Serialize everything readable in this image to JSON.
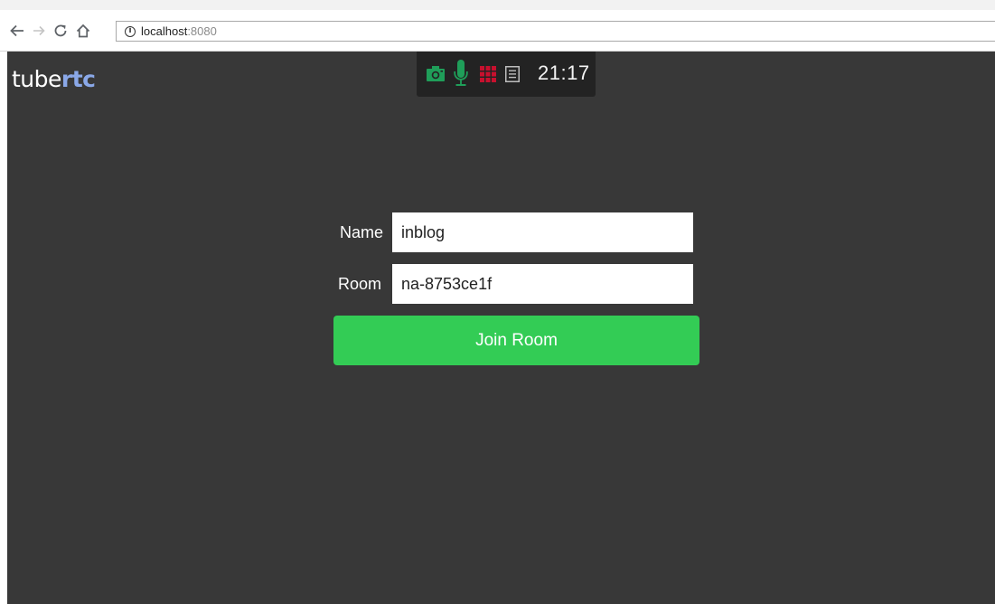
{
  "browser": {
    "url_host": "localhost",
    "url_port": ":8080",
    "icons": [
      "back-arrow-icon",
      "forward-arrow-icon",
      "reload-icon",
      "home-icon",
      "info-icon"
    ]
  },
  "app": {
    "brand_part1": "tube",
    "brand_part2": "rtc",
    "brand_colors": {
      "part1": "#ffffff",
      "part2": "#8aa8e8"
    }
  },
  "status_bar": {
    "time": "21:17",
    "icons": [
      {
        "name": "camera-icon",
        "color": "#1f9e59"
      },
      {
        "name": "microphone-icon",
        "color": "#1f9e59"
      },
      {
        "name": "grid-icon",
        "color": "#c8102e"
      },
      {
        "name": "document-icon",
        "color": "#bdbdbd"
      }
    ]
  },
  "form": {
    "name_label": "Name",
    "name_value": "inblog",
    "room_label": "Room",
    "room_value": "na-8753ce1f",
    "join_label": "Join Room",
    "join_color": "#33cc55"
  }
}
